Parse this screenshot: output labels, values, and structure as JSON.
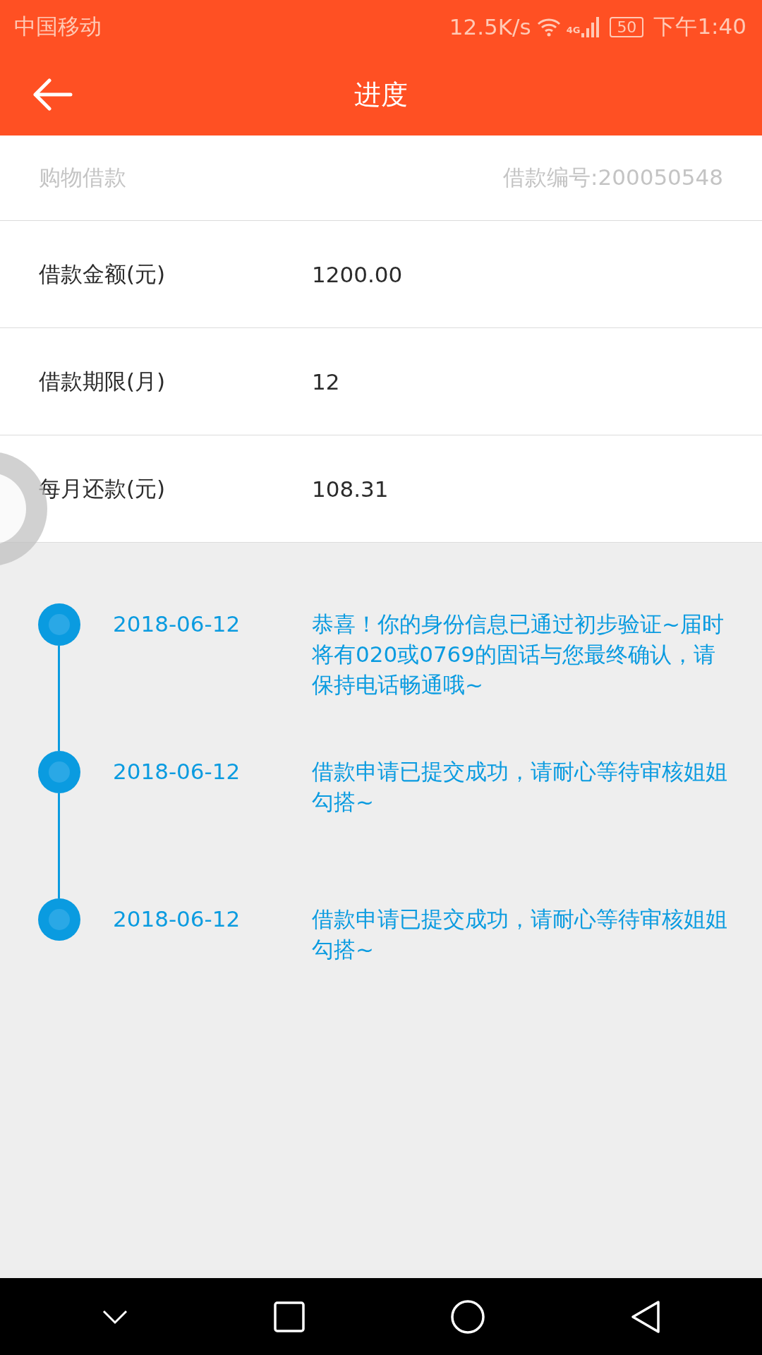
{
  "status_bar": {
    "carrier": "中国移动",
    "speed": "12.5K/s",
    "network": "4G",
    "battery": "50",
    "time": "下午1:40"
  },
  "toolbar": {
    "title": "进度"
  },
  "loan": {
    "type": "购物借款",
    "number": "借款编号:200050548"
  },
  "details": [
    {
      "label": "借款金额(元)",
      "value": "1200.00"
    },
    {
      "label": "借款期限(月)",
      "value": "12"
    },
    {
      "label": "每月还款(元)",
      "value": "108.31"
    }
  ],
  "timeline": [
    {
      "date": "2018-06-12",
      "text": "恭喜！你的身份信息已通过初步验证~届时将有020或0769的固话与您最终确认，请保持电话畅通哦~"
    },
    {
      "date": "2018-06-12",
      "text": "借款申请已提交成功，请耐心等待审核姐姐勾搭~"
    },
    {
      "date": "2018-06-12",
      "text": "借款申请已提交成功，请耐心等待审核姐姐勾搭~"
    }
  ]
}
